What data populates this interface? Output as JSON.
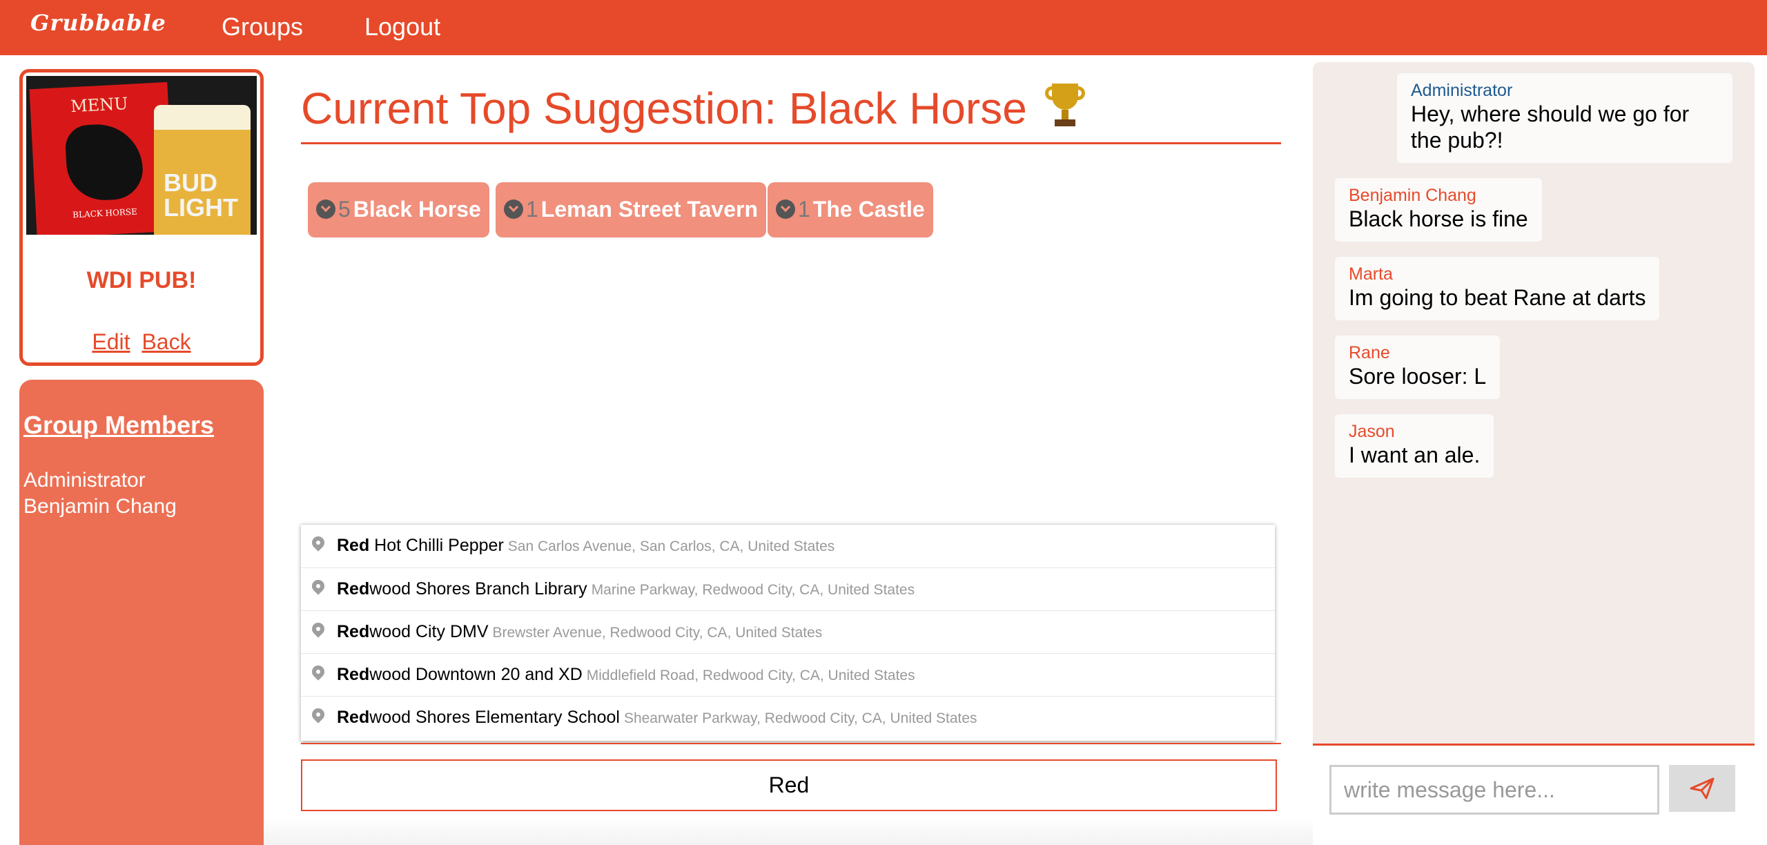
{
  "app": {
    "brand": "Grubbable"
  },
  "nav": {
    "groups_label": "Groups",
    "logout_label": "Logout"
  },
  "group": {
    "name": "WDI PUB!",
    "photo_menu_text": "MENU",
    "photo_board_text": "BLACK HORSE",
    "photo_glass_text": "BUD LIGHT",
    "edit_label": "Edit",
    "back_label": "Back"
  },
  "members": {
    "title": "Group Members",
    "list": [
      "Administrator",
      "Benjamin Chang"
    ]
  },
  "main": {
    "title": "Current Top Suggestion: Black Horse",
    "trophy_icon": "trophy-icon"
  },
  "suggestions": [
    {
      "count": "5",
      "name": "Black Horse"
    },
    {
      "count": "1",
      "name": "Leman Street Tavern"
    },
    {
      "count": "1",
      "name": "The Castle"
    }
  ],
  "autocomplete": [
    {
      "match": "Red",
      "rest": " Hot Chilli Pepper",
      "address": "San Carlos Avenue, San Carlos, CA, United States"
    },
    {
      "match": "Red",
      "rest": "wood Shores Branch Library",
      "address": "Marine Parkway, Redwood City, CA, United States"
    },
    {
      "match": "Red",
      "rest": "wood City DMV",
      "address": "Brewster Avenue, Redwood City, CA, United States"
    },
    {
      "match": "Red",
      "rest": "wood Downtown 20 and XD",
      "address": "Middlefield Road, Redwood City, CA, United States"
    },
    {
      "match": "Red",
      "rest": "wood Shores Elementary School",
      "address": "Shearwater Parkway, Redwood City, CA, United States"
    }
  ],
  "search": {
    "value": "Red"
  },
  "chat": {
    "messages": [
      {
        "author": "Administrator",
        "text": "Hey, where should we go for the pub?!"
      },
      {
        "author": "Benjamin Chang",
        "text": "Black horse is fine"
      },
      {
        "author": "Marta",
        "text": "Im going to beat Rane at darts"
      },
      {
        "author": "Rane",
        "text": "Sore looser: L"
      },
      {
        "author": "Jason",
        "text": "I want an ale."
      }
    ],
    "input_placeholder": "write message here...",
    "send_icon": "paper-plane-icon"
  },
  "colors": {
    "primary": "#e64a2a",
    "chip": "#f0907d",
    "members_panel": "#ec6f53",
    "chat_panel": "#f2ebe8",
    "admin_name": "#1f5a8f"
  }
}
